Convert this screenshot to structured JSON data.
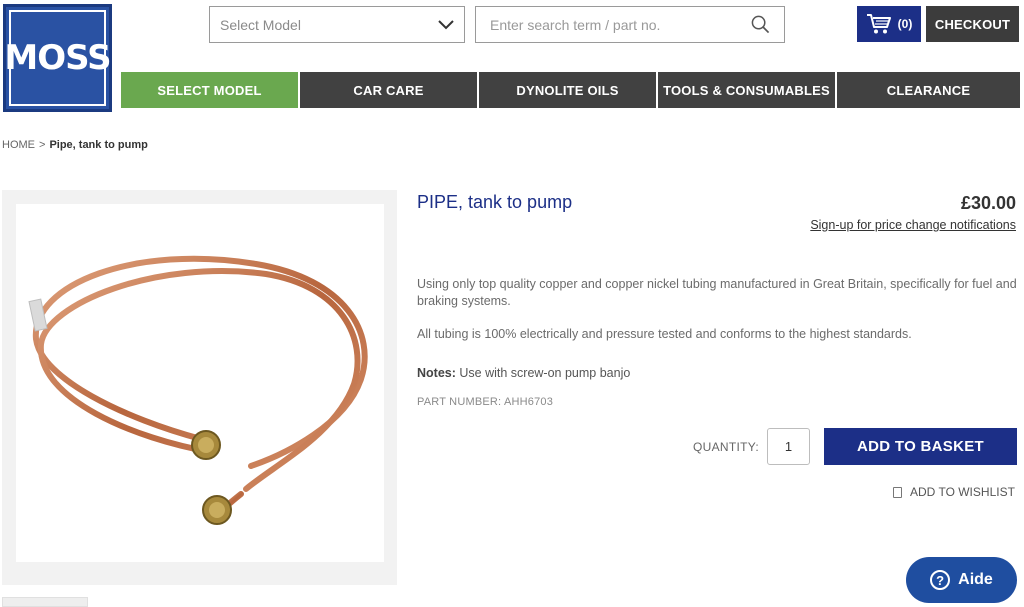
{
  "brand": {
    "logo_text": "MOSS",
    "accent": "#1c2f87",
    "nav_active": "#6aa84f",
    "nav_bg": "#414141"
  },
  "header": {
    "model_select": {
      "value": "Select Model"
    },
    "search": {
      "placeholder": "Enter search term / part no."
    },
    "cart": {
      "count": "(0)"
    },
    "checkout_label": "CHECKOUT"
  },
  "nav": {
    "items": [
      {
        "label": "SELECT MODEL",
        "active": true
      },
      {
        "label": "CAR CARE",
        "active": false
      },
      {
        "label": "DYNOLITE OILS",
        "active": false
      },
      {
        "label": "TOOLS & CONSUMABLES",
        "active": false
      },
      {
        "label": "CLEARANCE",
        "active": false
      }
    ]
  },
  "breadcrumb": {
    "home": "HOME",
    "separator": ">",
    "current": "Pipe, tank to pump"
  },
  "product": {
    "title": "PIPE, tank to pump",
    "price": "£30.00",
    "price_link": "Sign-up for price change notifications",
    "description_1": "Using only top quality copper and copper nickel tubing manufactured in Great Britain, specifically for fuel and braking systems.",
    "description_2": "All tubing is 100% electrically and pressure tested and conforms to the highest standards.",
    "notes_label": "Notes:",
    "notes_value": "Use with screw-on pump banjo",
    "part_number": "PART NUMBER: AHH6703"
  },
  "purchase": {
    "quantity_label": "QUANTITY:",
    "quantity_value": "1",
    "add_to_basket": "ADD TO BASKET",
    "wishlist": "ADD TO WISHLIST"
  },
  "help": {
    "label": "Aide",
    "icon": "?"
  }
}
